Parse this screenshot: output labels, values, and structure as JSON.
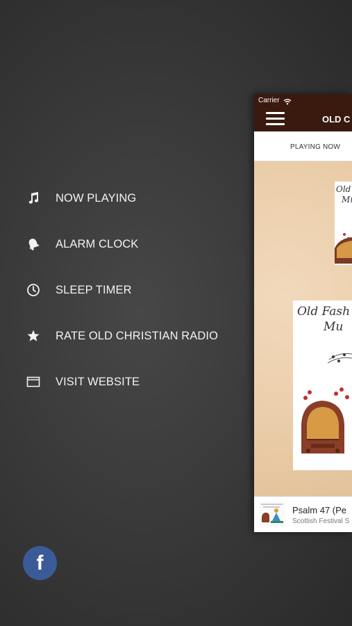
{
  "menu": {
    "items": [
      {
        "label": "NOW PLAYING",
        "icon": "music-note-icon"
      },
      {
        "label": "ALARM CLOCK",
        "icon": "bell-icon"
      },
      {
        "label": "SLEEP TIMER",
        "icon": "clock-icon"
      },
      {
        "label": "RATE OLD CHRISTIAN RADIO",
        "icon": "star-icon"
      },
      {
        "label": "VISIT WEBSITE",
        "icon": "browser-window-icon"
      }
    ]
  },
  "social": {
    "facebook_glyph": "f"
  },
  "phone": {
    "status": {
      "carrier": "Carrier"
    },
    "nav": {
      "title": "OLD C"
    },
    "tab": {
      "label": "PLAYING NOW"
    },
    "artwork": {
      "line1": "Old Fash",
      "line2": "Mu",
      "small_line1": "Old Fa",
      "small_line2": "Mu"
    },
    "player": {
      "track": "Psalm 47  (Pe",
      "artist": "Scottish Festival S"
    }
  },
  "colors": {
    "facebook": "#3b5a98",
    "navbar": "#3a1a0f",
    "background": "#3a3a3a"
  }
}
